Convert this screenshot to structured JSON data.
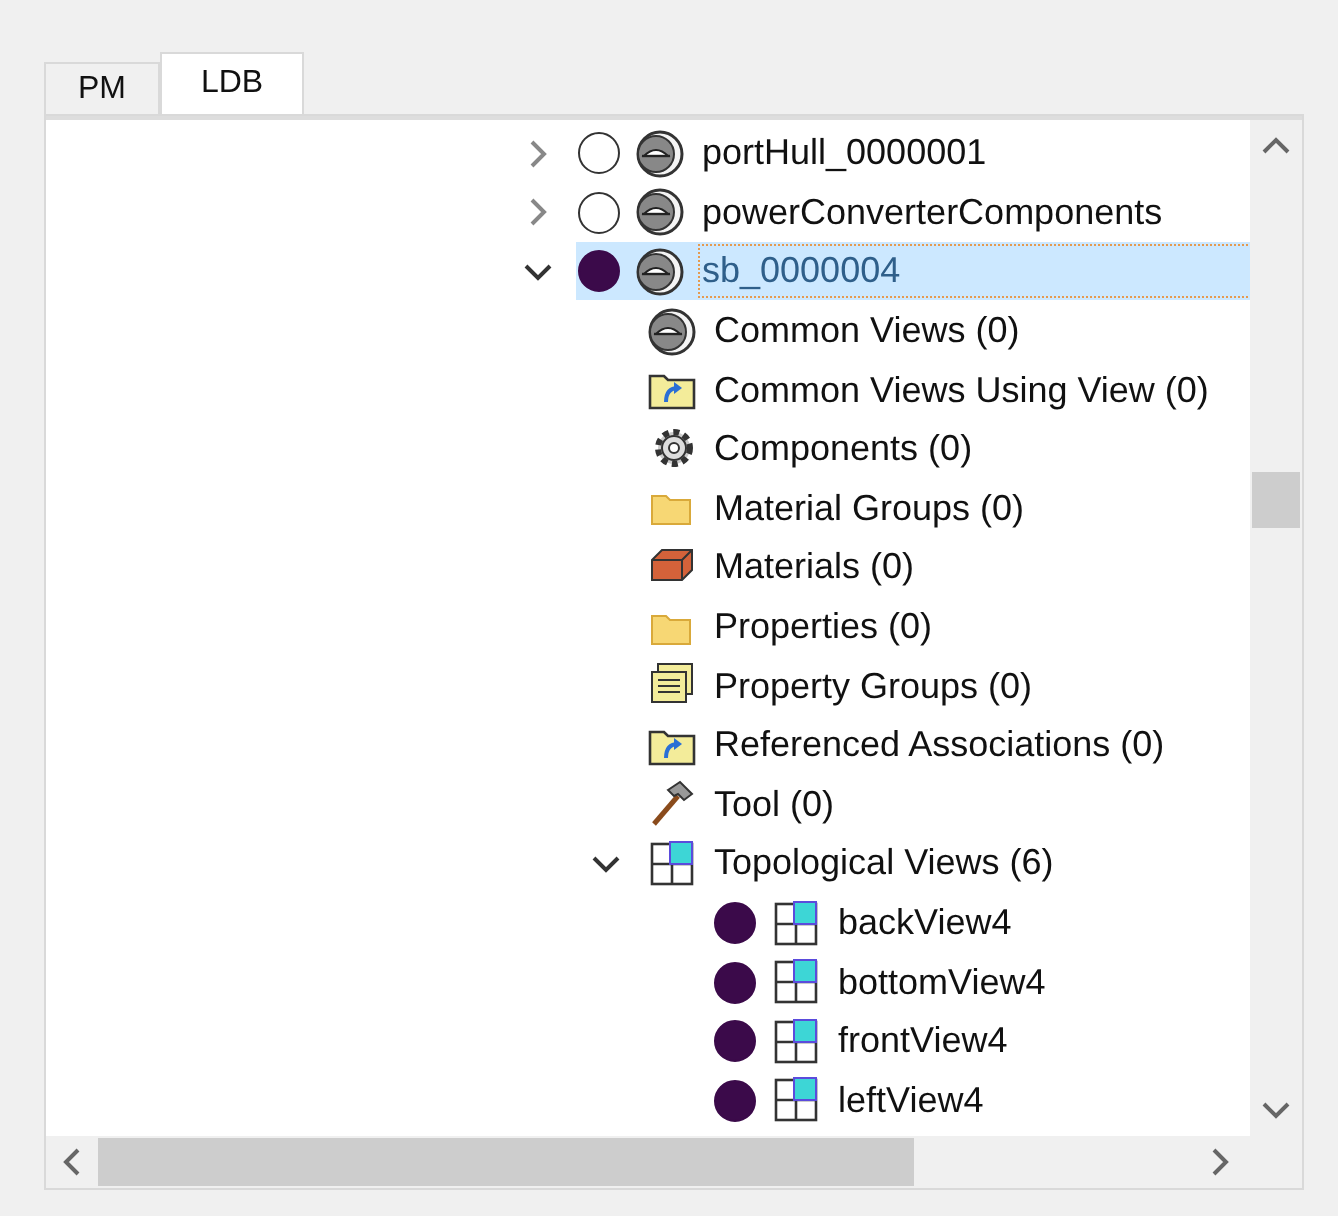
{
  "tabs": [
    {
      "label": "PM",
      "selected": false
    },
    {
      "label": "LDB",
      "selected": true
    }
  ],
  "tree": [
    {
      "label": "portHull_0000001",
      "kind": "part",
      "marked": false,
      "expanded": false,
      "selected": false
    },
    {
      "label": "powerConverterComponents",
      "kind": "part",
      "marked": false,
      "expanded": false,
      "selected": false
    },
    {
      "label": "sb_0000004",
      "kind": "part",
      "marked": true,
      "expanded": true,
      "selected": true,
      "children": [
        {
          "label": "Common Views (0)",
          "kind": "part",
          "selected": false
        },
        {
          "label": "Common Views Using View (0)",
          "kind": "link-folder",
          "selected": false
        },
        {
          "label": "Components (0)",
          "kind": "gear",
          "selected": false
        },
        {
          "label": "Material Groups (0)",
          "kind": "folder",
          "selected": false
        },
        {
          "label": "Materials (0)",
          "kind": "brick",
          "selected": false
        },
        {
          "label": "Properties (0)",
          "kind": "folder",
          "selected": false
        },
        {
          "label": "Property Groups (0)",
          "kind": "stack",
          "selected": false
        },
        {
          "label": "Referenced Associations (0)",
          "kind": "link-folder",
          "selected": false
        },
        {
          "label": "Tool (0)",
          "kind": "hammer",
          "selected": false
        },
        {
          "label": "Topological Views (6)",
          "kind": "grid",
          "expanded": true,
          "selected": false,
          "children": [
            {
              "label": "backView4",
              "kind": "grid",
              "marked": true,
              "selected": false
            },
            {
              "label": "bottomView4",
              "kind": "grid",
              "marked": true,
              "selected": false
            },
            {
              "label": "frontView4",
              "kind": "grid",
              "marked": true,
              "selected": false
            },
            {
              "label": "leftView4",
              "kind": "grid",
              "marked": true,
              "selected": false
            }
          ]
        }
      ]
    }
  ]
}
